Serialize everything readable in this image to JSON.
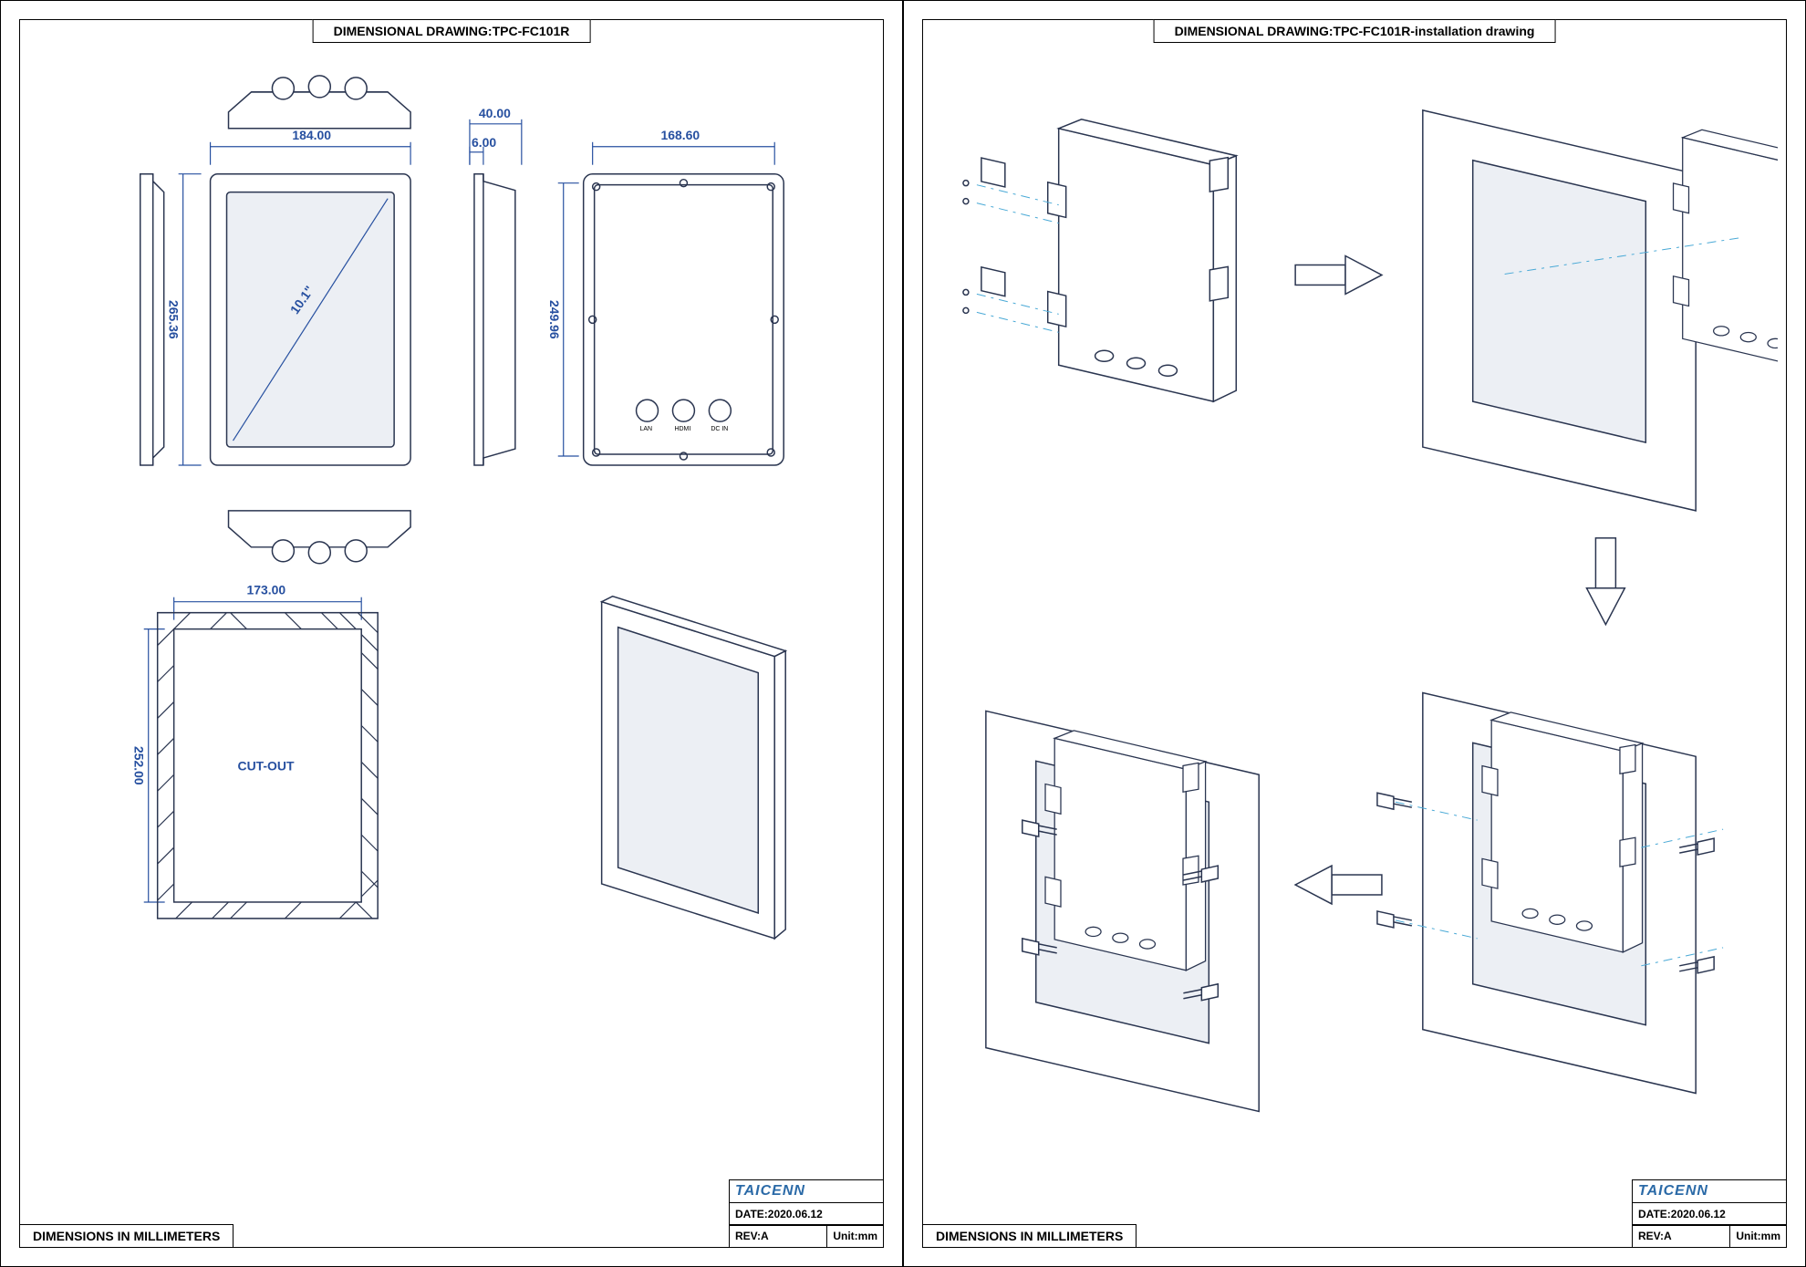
{
  "sheet_left": {
    "title": "DIMENSIONAL DRAWING:TPC-FC101R",
    "dim_note": "DIMENSIONS IN MILLIMETERS",
    "brand": "TAICENN",
    "date_label": "DATE:2020.06.12",
    "rev_label": "REV:A",
    "unit_label": "Unit:mm",
    "dimensions": {
      "front_width": "184.00",
      "front_height": "265.36",
      "depth_total": "40.00",
      "depth_step": "6.00",
      "rear_width": "168.60",
      "rear_height": "249.96",
      "diagonal": "10.1\"",
      "cutout_width": "173.00",
      "cutout_height": "252.00",
      "cutout_label": "CUT-OUT"
    },
    "connector_labels": [
      "LAN",
      "HDMI",
      "DC IN"
    ]
  },
  "sheet_right": {
    "title": "DIMENSIONAL DRAWING:TPC-FC101R-installation drawing",
    "dim_note": "DIMENSIONS IN MILLIMETERS",
    "brand": "TAICENN",
    "date_label": "DATE:2020.06.12",
    "rev_label": "REV:A",
    "unit_label": "Unit:mm"
  }
}
